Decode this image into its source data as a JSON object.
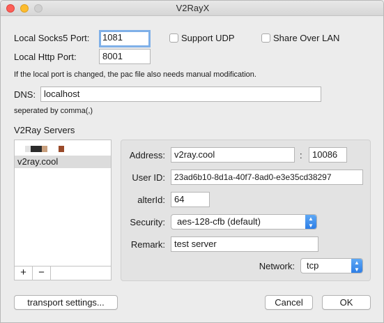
{
  "window": {
    "title": "V2RayX"
  },
  "local": {
    "socks_label": "Local Socks5 Port:",
    "socks_value": "1081",
    "support_udp_label": "Support UDP",
    "share_lan_label": "Share Over LAN",
    "http_label": "Local Http Port:",
    "http_value": "8001",
    "note": "If the local port is changed, the pac file also needs manual modification."
  },
  "dns": {
    "label": "DNS:",
    "value": "localhost",
    "note": "seperated by comma(,)"
  },
  "servers": {
    "section_label": "V2Ray Servers",
    "items": [
      "v2ray.cool"
    ],
    "add_label": "+",
    "remove_label": "−"
  },
  "server_detail": {
    "address_label": "Address:",
    "address_value": "v2ray.cool",
    "colon": ":",
    "port_value": "10086",
    "userid_label": "User ID:",
    "userid_value": "23ad6b10-8d1a-40f7-8ad0-e3e35cd38297",
    "alterid_label": "alterId:",
    "alterid_value": "64",
    "security_label": "Security:",
    "security_value": "aes-128-cfb (default)",
    "remark_label": "Remark:",
    "remark_value": "test server",
    "network_label": "Network:",
    "network_value": "tcp"
  },
  "buttons": {
    "transport": "transport settings...",
    "cancel": "Cancel",
    "ok": "OK"
  },
  "colors": {
    "window_bg": "#ececec",
    "popup_accent": "#2d7ee6",
    "focus_ring": "#7fb0e8",
    "selection_bg": "#dcdcdc"
  }
}
